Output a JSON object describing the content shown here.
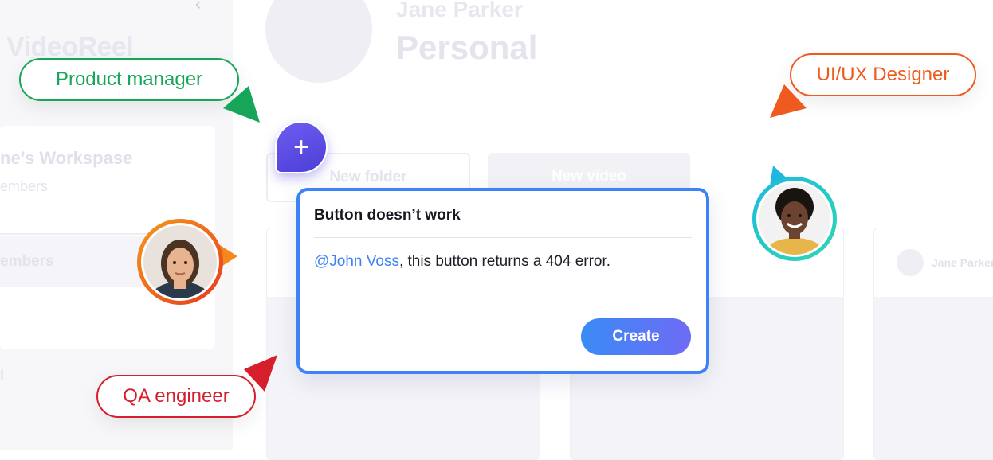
{
  "background": {
    "brand": "VideoReel",
    "workspace_name": "ne’s Workspase",
    "workspace_members": "embers",
    "sidebar_members": "embers",
    "sidebar_bottom": "l",
    "profile_name": "Jane Parker",
    "profile_type": "Personal",
    "new_folder_label": "New folder",
    "new_video_label": "New video",
    "card_author": "Jane Parker"
  },
  "comment": {
    "title": "Button doesn’t work",
    "mention": "@John Voss",
    "body": ", this button returns a 404 error.",
    "create_label": "Create"
  },
  "roles": {
    "product_manager": "Product  manager",
    "ux_designer": "UI/UX Designer",
    "qa_engineer": "QA engineer"
  },
  "colors": {
    "accent_blue": "#3d82f7",
    "product_manager": "#17a659",
    "ux_designer": "#ef5a1f",
    "qa_engineer": "#d71e2d",
    "pin": "#5b4de6"
  },
  "icons": {
    "pin": "plus-icon",
    "collapse": "chevron-left-icon"
  }
}
